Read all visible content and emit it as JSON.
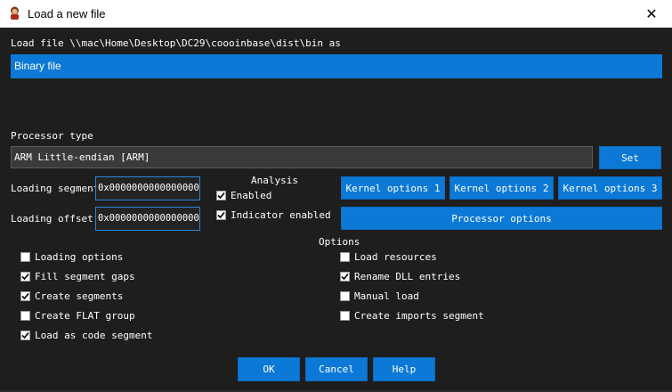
{
  "window": {
    "title": "Load a new file",
    "close_glyph": "✕"
  },
  "load_file_label": "Load file \\\\mac\\Home\\Desktop\\DC29\\coooinbase\\dist\\bin as",
  "file_types": [
    "Binary file"
  ],
  "processor": {
    "label": "Processor type",
    "value": "ARM Little-endian [ARM]",
    "set_button": "Set"
  },
  "loading": {
    "segment_label": "Loading segment",
    "segment_value": "0x0000000000000000",
    "offset_label": "Loading offset",
    "offset_value": "0x0000000000000000"
  },
  "analysis": {
    "title": "Analysis",
    "items": [
      {
        "label": "Enabled",
        "checked": true
      },
      {
        "label": "Indicator enabled",
        "checked": true
      }
    ]
  },
  "kernel_buttons": [
    "Kernel options 1",
    "Kernel options 2",
    "Kernel options 3"
  ],
  "processor_options_button": "Processor options",
  "options": {
    "title": "Options",
    "left": [
      {
        "label": "Loading options",
        "checked": false
      },
      {
        "label": "Fill segment gaps",
        "checked": true
      },
      {
        "label": "Create segments",
        "checked": true
      },
      {
        "label": "Create FLAT group",
        "checked": false
      },
      {
        "label": "Load as code segment",
        "checked": true
      }
    ],
    "right": [
      {
        "label": "Load resources",
        "checked": false
      },
      {
        "label": "Rename DLL entries",
        "checked": true
      },
      {
        "label": "Manual load",
        "checked": false
      },
      {
        "label": "Create imports segment",
        "checked": false
      }
    ]
  },
  "dialog_buttons": {
    "ok": "OK",
    "cancel": "Cancel",
    "help": "Help"
  },
  "colors": {
    "accent": "#0c79d6",
    "background": "#1e1e1e",
    "title_bar": "#ffffff"
  }
}
